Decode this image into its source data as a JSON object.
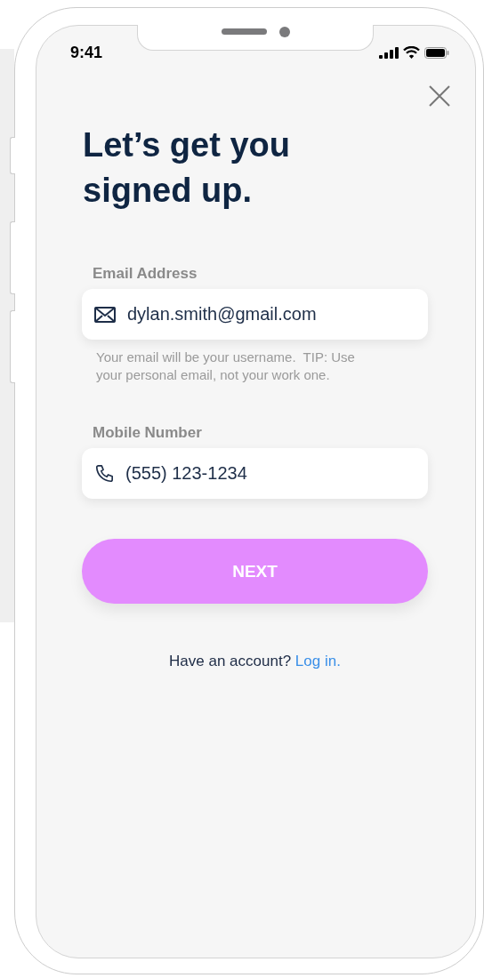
{
  "status_bar": {
    "time": "9:41"
  },
  "title": "Let’s get you signed up.",
  "fields": [
    {
      "label": "Email Address",
      "kind": "email",
      "value": "dylan.smith@gmail.com",
      "hint": "Your email will be your username.  TIP: Use your personal email, not your work one."
    },
    {
      "label": "Mobile Number",
      "kind": "phone",
      "value": "(555) 123-1234"
    }
  ],
  "next_button": {
    "label": "NEXT"
  },
  "footer": {
    "text": "Have an account?",
    "link": "Log in."
  }
}
